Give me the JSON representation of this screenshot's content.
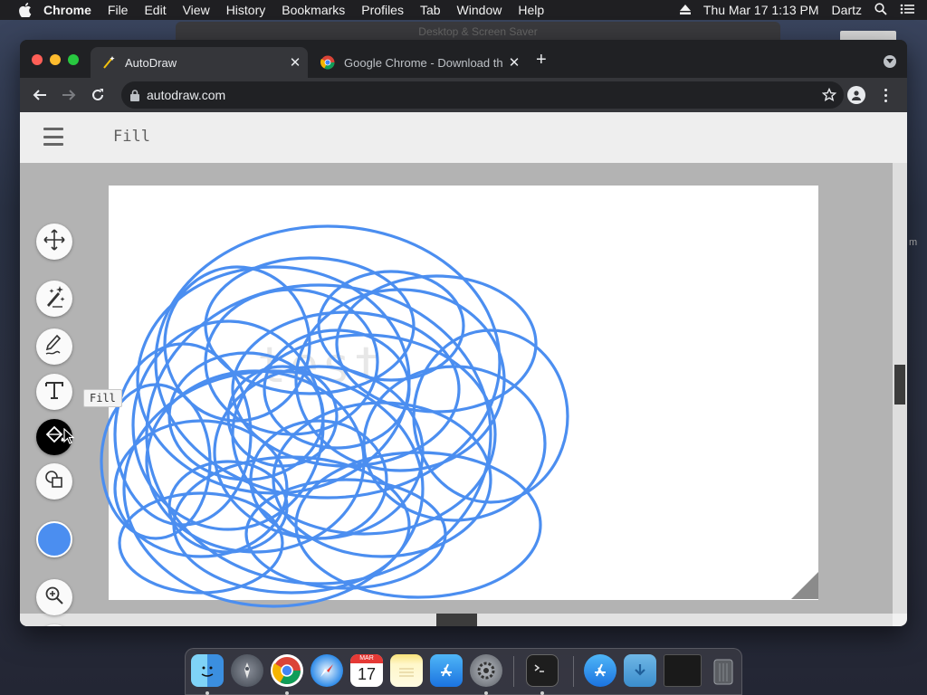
{
  "menubar": {
    "app_name": "Chrome",
    "items": [
      "File",
      "Edit",
      "View",
      "History",
      "Bookmarks",
      "Profiles",
      "Tab",
      "Window",
      "Help"
    ],
    "datetime": "Thu Mar 17  1:13 PM",
    "user": "Dartz"
  },
  "background_window": {
    "title": "Desktop & Screen Saver"
  },
  "browser": {
    "tabs": [
      {
        "title": "AutoDraw",
        "active": true
      },
      {
        "title": "Google Chrome - Download th",
        "active": false
      }
    ],
    "url": "autodraw.com"
  },
  "autodraw": {
    "current_tool": "Fill",
    "tooltip": "Fill",
    "canvas_text": "test",
    "selected_color": "#4b8ef0",
    "tools": [
      "move",
      "autodraw",
      "draw",
      "type",
      "fill",
      "shape"
    ]
  },
  "dock": {
    "apps": [
      "Finder",
      "Launchpad",
      "Google Chrome",
      "Safari",
      "Calendar",
      "Notes",
      "App Store",
      "System Preferences",
      "Terminal",
      "Applications",
      "Downloads",
      "Screen",
      "Trash"
    ],
    "calendar": {
      "month": "MAR",
      "day": "17"
    }
  }
}
